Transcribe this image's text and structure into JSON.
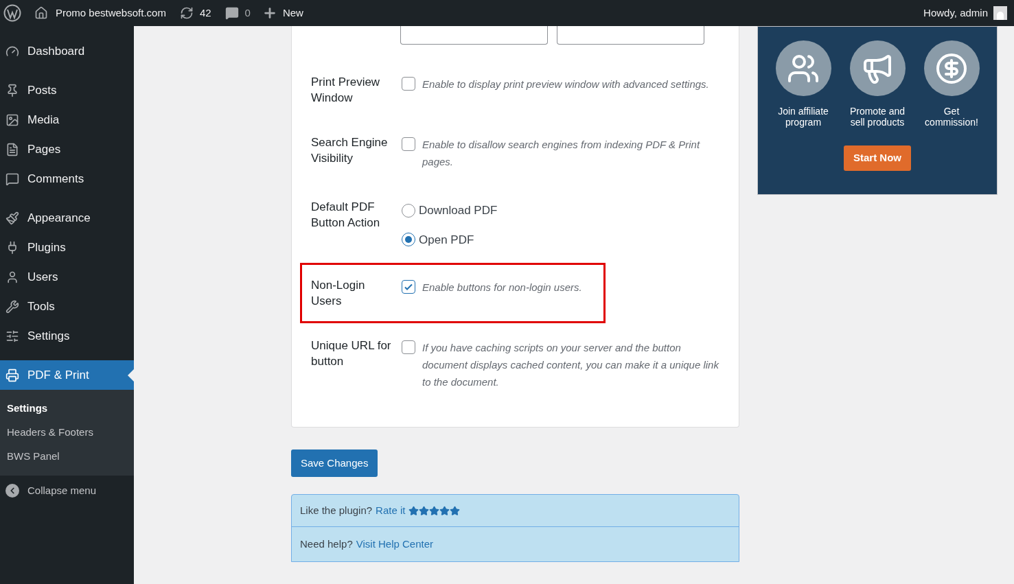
{
  "admin_bar": {
    "site": "Promo bestwebsoft.com",
    "updates": "42",
    "comments": "0",
    "new": "New",
    "greeting": "Howdy, admin"
  },
  "sidebar": {
    "items": [
      {
        "label": "Dashboard",
        "selected": false
      },
      {
        "label": "Posts",
        "selected": false
      },
      {
        "label": "Media",
        "selected": false
      },
      {
        "label": "Pages",
        "selected": false
      },
      {
        "label": "Comments",
        "selected": false
      },
      {
        "label": "Appearance",
        "selected": false
      },
      {
        "label": "Plugins",
        "selected": false
      },
      {
        "label": "Users",
        "selected": false
      },
      {
        "label": "Tools",
        "selected": false
      },
      {
        "label": "Settings",
        "selected": false
      },
      {
        "label": "PDF & Print",
        "selected": true
      }
    ],
    "submenu": [
      {
        "label": "Settings",
        "selected": true
      },
      {
        "label": "Headers & Footers",
        "selected": false
      },
      {
        "label": "BWS Panel",
        "selected": false
      }
    ],
    "collapse": "Collapse menu"
  },
  "settings": [
    {
      "kind": "checkbox",
      "label": "Print Preview Window",
      "highlighted": false,
      "checked": false,
      "description": "Enable to display print preview window with advanced settings."
    },
    {
      "kind": "checkbox",
      "label": "Search Engine Visibility",
      "highlighted": false,
      "checked": false,
      "description": "Enable to disallow search engines from indexing PDF & Print pages."
    },
    {
      "kind": "radio",
      "label": "Default PDF Button Action",
      "highlighted": false,
      "options": [
        {
          "label": "Download PDF",
          "selected": false
        },
        {
          "label": "Open PDF",
          "selected": true
        }
      ]
    },
    {
      "kind": "checkbox",
      "label": "Non-Login Users",
      "highlighted": true,
      "checked": true,
      "description": "Enable buttons for non-login users."
    },
    {
      "kind": "checkbox",
      "label": "Unique URL for button",
      "highlighted": false,
      "checked": false,
      "description": "If you have caching scripts on your server and the button document displays cached content, you can make it a unique link to the document."
    }
  ],
  "save_button": "Save Changes",
  "rating": {
    "text": "Like the plugin?",
    "link": "Rate it",
    "stars": 5
  },
  "help": {
    "text": "Need help?",
    "link": "Visit Help Center"
  },
  "banner": {
    "steps": [
      {
        "label": "Join affiliate program"
      },
      {
        "label": "Promote and sell products"
      },
      {
        "label": "Get commission!"
      }
    ],
    "button": "Start Now"
  }
}
